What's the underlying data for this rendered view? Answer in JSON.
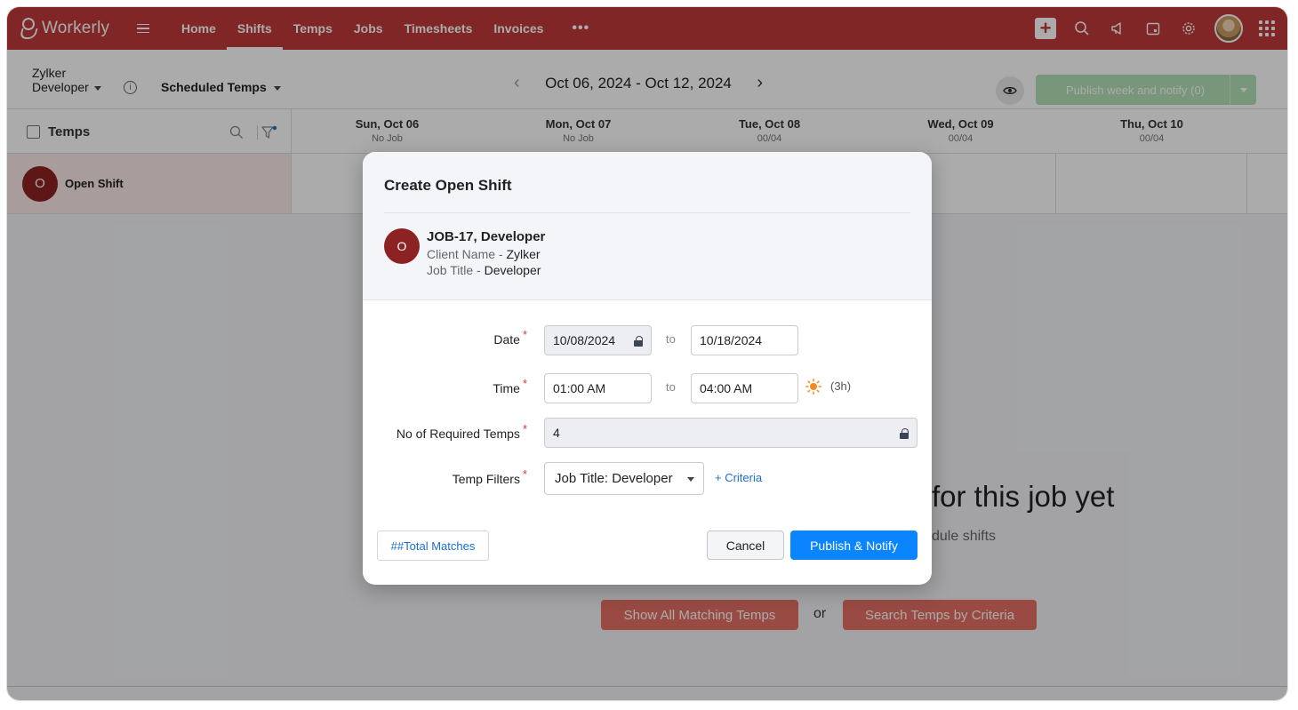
{
  "app": {
    "name": "Workerly"
  },
  "nav": {
    "items": [
      "Home",
      "Shifts",
      "Temps",
      "Jobs",
      "Timesheets",
      "Invoices"
    ],
    "active": "Shifts",
    "more": "•••"
  },
  "subheader": {
    "client": "Zylker",
    "job": "Developer",
    "view_select": "Scheduled Temps",
    "week_range": "Oct 06, 2024 - Oct 12, 2024",
    "publish_week_label": "Publish week and notify (0)"
  },
  "grid": {
    "temps_header": "Temps",
    "days": [
      {
        "day": "Sun, Oct 06",
        "status": "No Job"
      },
      {
        "day": "Mon, Oct 07",
        "status": "No Job"
      },
      {
        "day": "Tue, Oct 08",
        "status": "00/04"
      },
      {
        "day": "Wed, Oct 09",
        "status": "00/04"
      },
      {
        "day": "Thu, Oct 10",
        "status": "00/04"
      }
    ],
    "open_shift": {
      "initial": "O",
      "label": "Open Shift"
    }
  },
  "empty_state": {
    "title": "for this job yet",
    "subtitle": "dule shifts",
    "show_all_label": "Show All Matching Temps",
    "or_label": "or",
    "search_label": "Search Temps by Criteria"
  },
  "modal": {
    "title": "Create Open Shift",
    "job_initial": "O",
    "job_name": "JOB-17, Developer",
    "client_key": "Client Name",
    "client_value": "Zylker",
    "jobtitle_key": "Job Title",
    "jobtitle_value": "Developer",
    "separator": " - ",
    "date_label": "Date",
    "date_from": "10/08/2024",
    "date_to": "10/18/2024",
    "to_label": "to",
    "time_label": "Time",
    "time_from": "01:00 AM",
    "time_to": "04:00 AM",
    "duration": "(3h)",
    "required_label": "No of Required Temps",
    "required_value": "4",
    "filters_label": "Temp Filters",
    "filter_value": "Job Title: Developer",
    "criteria_link": "+ Criteria",
    "required_mark": "*",
    "total_matches": "##Total Matches",
    "cancel_label": "Cancel",
    "publish_label": "Publish & Notify"
  },
  "colors": {
    "brand": "#c0393b",
    "primary_button": "#0a84ff",
    "open_shift_avatar": "#8d2222",
    "publish_week_disabled": "#b4e0b6",
    "required_mark": "#e53935"
  }
}
